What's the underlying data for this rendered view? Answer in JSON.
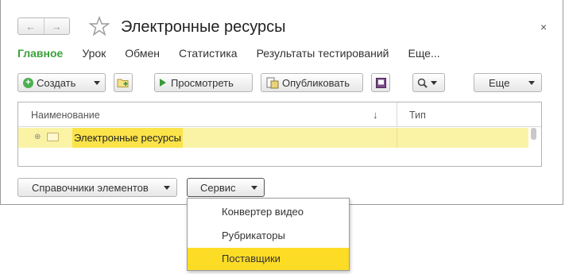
{
  "window": {
    "title": "Электронные ресурсы",
    "close_glyph": "×",
    "back_glyph": "←",
    "forward_glyph": "→"
  },
  "tabs": [
    {
      "label": "Главное",
      "active": true
    },
    {
      "label": "Урок"
    },
    {
      "label": "Обмен"
    },
    {
      "label": "Статистика"
    },
    {
      "label": "Результаты тестирований"
    },
    {
      "label": "Еще..."
    }
  ],
  "toolbar": {
    "create_label": "Создать",
    "view_label": "Просмотреть",
    "publish_label": "Опубликовать",
    "more_label": "Еще"
  },
  "table": {
    "columns": [
      "Наименование",
      "Тип"
    ],
    "sort_glyph": "↓",
    "rows": [
      {
        "name": "Электронные ресурсы",
        "type": ""
      }
    ]
  },
  "bottom": {
    "references_label": "Справочники элементов",
    "service_label": "Сервис"
  },
  "service_menu": {
    "items": [
      {
        "label": "Конвертер видео"
      },
      {
        "label": "Рубрикаторы"
      },
      {
        "label": "Поставщики",
        "selected": true
      }
    ]
  },
  "colors": {
    "active_tab": "#3ba03b",
    "row_highlight": "#faf3a6",
    "menu_selection": "#fddc26"
  }
}
